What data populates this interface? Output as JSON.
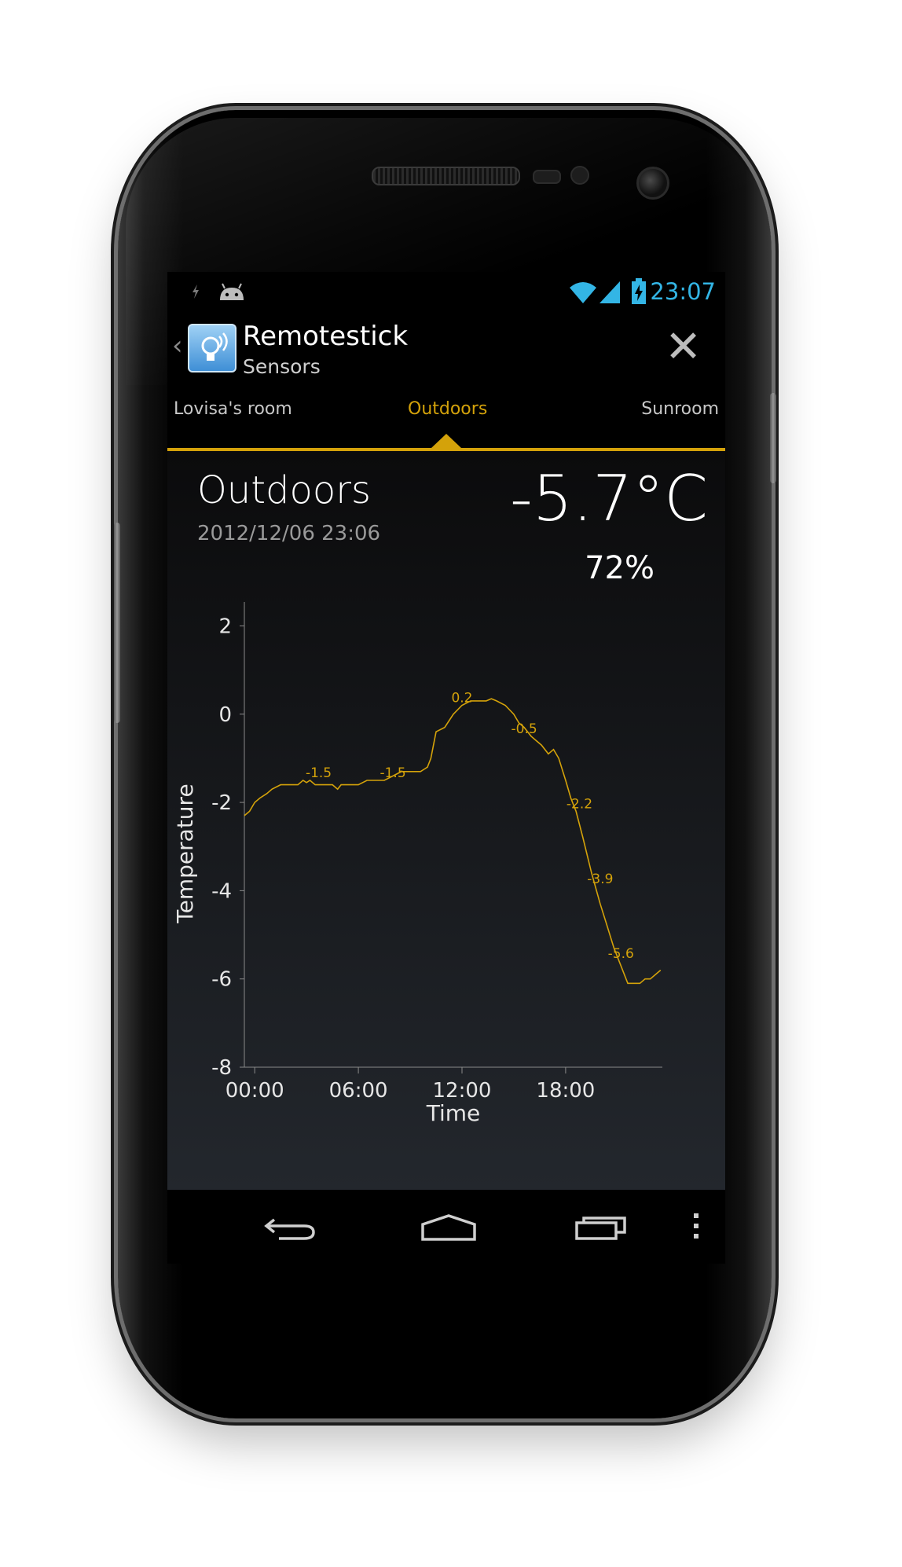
{
  "status_bar": {
    "time": "23:07",
    "accent_color": "#33b5e5",
    "icons": [
      "usb-debug-icon",
      "android-icon",
      "wifi-icon",
      "signal-icon",
      "battery-charging-icon"
    ]
  },
  "action_bar": {
    "app_title": "Remotestick",
    "app_subtitle": "Sensors",
    "icon": "sensor-bulb-icon"
  },
  "tabs": [
    {
      "label": "Lovisa's room",
      "active": false
    },
    {
      "label": "Outdoors",
      "active": true
    },
    {
      "label": "Sunroom",
      "active": false
    }
  ],
  "sensor": {
    "name": "Outdoors",
    "timestamp": "2012/12/06 23:06",
    "temperature": "-5.7°C",
    "humidity": "72%"
  },
  "chart_data": {
    "type": "line",
    "xlabel": "Time",
    "ylabel": "Temperature",
    "x_ticks": [
      "00:00",
      "06:00",
      "12:00",
      "18:00"
    ],
    "y_ticks": [
      2,
      0,
      -2,
      -4,
      -6,
      -8
    ],
    "ylim": [
      -8,
      2.4
    ],
    "xlim_hours": [
      -0.6,
      23.6
    ],
    "line_color": "#d4a20a",
    "series": [
      {
        "x": [
          -0.6,
          -0.3,
          0,
          0.3,
          0.7,
          1.0,
          1.5,
          2,
          2.5,
          2.8,
          3.0,
          3.2,
          3.5,
          3.8,
          4.2,
          4.5,
          4.8,
          5.0,
          5.3,
          5.7,
          6,
          6.5,
          7,
          7.5,
          8,
          8.5,
          9,
          9.3,
          9.6,
          9.8,
          10.0,
          10.2,
          10.5,
          11,
          11.5,
          12,
          12.5,
          13,
          13.4,
          13.7,
          14,
          14.5,
          15,
          15.3,
          15.6,
          16,
          16.3,
          16.6,
          17,
          17.3,
          17.6,
          18,
          18.3,
          18.6,
          19,
          19.5,
          20,
          20.4,
          20.8,
          21.2,
          21.6,
          22,
          22.3,
          22.6,
          22.9,
          23.2,
          23.5
        ],
        "y": [
          -2.3,
          -2.2,
          -2.0,
          -1.9,
          -1.8,
          -1.7,
          -1.6,
          -1.6,
          -1.6,
          -1.5,
          -1.55,
          -1.5,
          -1.6,
          -1.6,
          -1.6,
          -1.6,
          -1.7,
          -1.6,
          -1.6,
          -1.6,
          -1.6,
          -1.5,
          -1.5,
          -1.5,
          -1.4,
          -1.3,
          -1.3,
          -1.3,
          -1.3,
          -1.25,
          -1.2,
          -1.0,
          -0.4,
          -0.3,
          0.0,
          0.2,
          0.3,
          0.3,
          0.3,
          0.35,
          0.3,
          0.2,
          0.0,
          -0.2,
          -0.3,
          -0.5,
          -0.6,
          -0.7,
          -0.9,
          -0.8,
          -1.0,
          -1.5,
          -1.9,
          -2.2,
          -2.8,
          -3.6,
          -4.3,
          -4.8,
          -5.3,
          -5.7,
          -6.1,
          -6.1,
          -6.1,
          -6.0,
          -6.0,
          -5.9,
          -5.8
        ]
      }
    ],
    "point_labels": [
      {
        "x": 3.7,
        "y": -1.5,
        "text": "-1.5"
      },
      {
        "x": 8.0,
        "y": -1.5,
        "text": "-1.5"
      },
      {
        "x": 12.0,
        "y": 0.2,
        "text": "0.2"
      },
      {
        "x": 15.6,
        "y": -0.5,
        "text": "-0.5"
      },
      {
        "x": 18.8,
        "y": -2.2,
        "text": "-2.2"
      },
      {
        "x": 20.0,
        "y": -3.9,
        "text": "-3.9"
      },
      {
        "x": 21.2,
        "y": -5.6,
        "text": "-5.6"
      }
    ],
    "grid": false
  },
  "nav_bar": {
    "icons": [
      "back-icon",
      "home-icon",
      "recent-apps-icon",
      "overflow-menu-icon"
    ]
  }
}
